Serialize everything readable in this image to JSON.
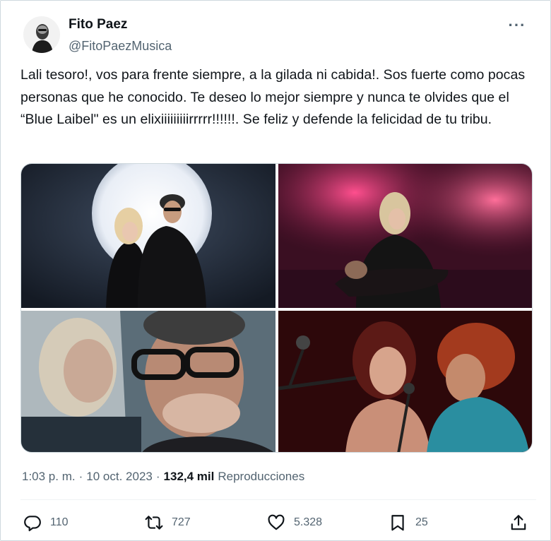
{
  "author": {
    "display_name": "Fito Paez",
    "handle": "@FitoPaezMusica",
    "more_icon": "more-horizontal-icon"
  },
  "tweet": {
    "text": "Lali tesoro!, vos para frente siempre, a la gilada ni cabida!. Sos fuerte como pocas personas que he conocido. Te deseo lo mejor siempre y nunca te olvides que el “Blue Laibel\" es un elixiiiiiiiiirrrrr!!!!!!. Se feliz y defende la felicidad de tu tribu."
  },
  "meta": {
    "time": "1:03 p. m.",
    "separator": "·",
    "date": "10 oct. 2023",
    "views_count": "132,4 mil",
    "views_label": "Reproducciones"
  },
  "actions": {
    "reply": {
      "icon": "reply-icon",
      "count": "110"
    },
    "retweet": {
      "icon": "retweet-icon",
      "count": "727"
    },
    "like": {
      "icon": "heart-icon",
      "count": "5.328"
    },
    "bookmark": {
      "icon": "bookmark-icon",
      "count": "25"
    },
    "share": {
      "icon": "share-icon"
    }
  },
  "colors": {
    "text": "#0f1419",
    "secondary": "#536471",
    "border": "#cfd9de"
  }
}
